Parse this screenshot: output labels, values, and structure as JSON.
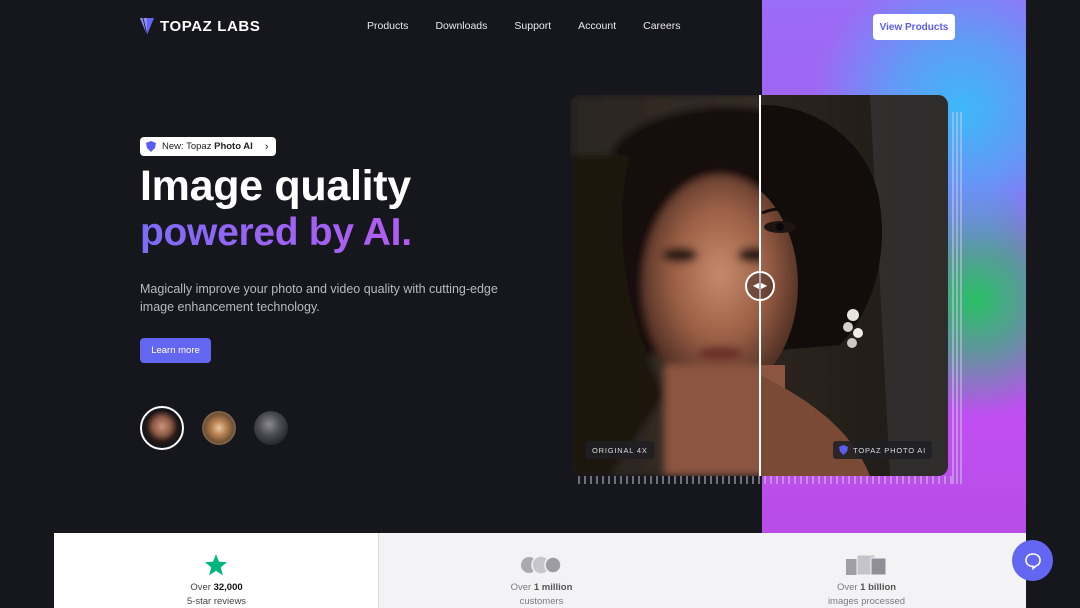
{
  "nav": {
    "brand": "TOPAZ LABS",
    "links": [
      "Products",
      "Downloads",
      "Support",
      "Account",
      "Careers"
    ],
    "cta": "View Products"
  },
  "hero": {
    "badge_prefix": "New: Topaz ",
    "badge_bold": "Photo AI",
    "title_line1": "Image quality",
    "title_line2": "powered by AI.",
    "subtitle": "Magically improve your photo and video quality with cutting-edge image enhancement technology.",
    "cta": "Learn more"
  },
  "compare": {
    "left_label": "ORIGINAL 4X",
    "right_label": "TOPAZ PHOTO AI",
    "slider_position": 0.5
  },
  "thumbnails": [
    {
      "icon": "portrait-thumbnail",
      "active": true
    },
    {
      "icon": "tiger-thumbnail",
      "active": false
    },
    {
      "icon": "bird-thumbnail",
      "active": false
    }
  ],
  "stats": [
    {
      "pre": "Over ",
      "strong": "32,000",
      "line2": "5-star reviews",
      "icon": "star-icon"
    },
    {
      "pre": "Over ",
      "strong": "1 million",
      "line2": "customers",
      "icon": "people-icon"
    },
    {
      "pre": "Over ",
      "strong": "1 billion",
      "line2": "images processed",
      "icon": "images-icon"
    }
  ],
  "colors": {
    "background": "#16161d",
    "accent": "#6366f1",
    "gradient_purple": "#a55cf2",
    "gradient_blue": "#38bdf8",
    "gradient_green": "#22c55e",
    "star_green": "#00b67a"
  }
}
